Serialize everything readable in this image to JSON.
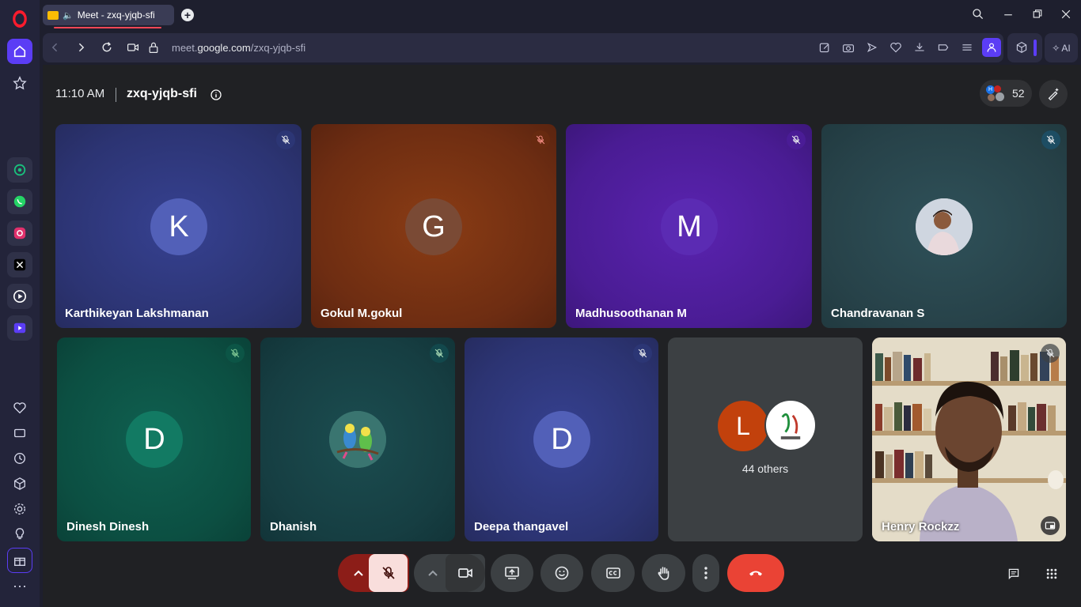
{
  "browser": {
    "tab_title": "Meet - zxq-yjqb-sfi",
    "url_prefix": "meet.",
    "url_domain": "google.com",
    "url_path": "/zxq-yjqb-sfi",
    "ai_label": "AI"
  },
  "meeting": {
    "time": "11:10 AM",
    "code": "zxq-yjqb-sfi",
    "participant_count": "52",
    "others_label": "44 others"
  },
  "participants": [
    {
      "initial": "K",
      "name": "Karthikeyan Lakshmanan"
    },
    {
      "initial": "G",
      "name": "Gokul M.gokul"
    },
    {
      "initial": "M",
      "name": "Madhusoothanan M"
    },
    {
      "initial": "",
      "name": "Chandravanan S"
    },
    {
      "initial": "D",
      "name": "Dinesh Dinesh"
    },
    {
      "initial": "",
      "name": "Dhanish"
    },
    {
      "initial": "D",
      "name": "Deepa thangavel"
    },
    {
      "initial": "L",
      "name": ""
    },
    {
      "initial": "",
      "name": "Henry Rockzz"
    }
  ],
  "colors": {
    "end_call": "#ea4335",
    "mic_off_bg": "#f9dedc",
    "accent_purple": "#5b3df5"
  }
}
